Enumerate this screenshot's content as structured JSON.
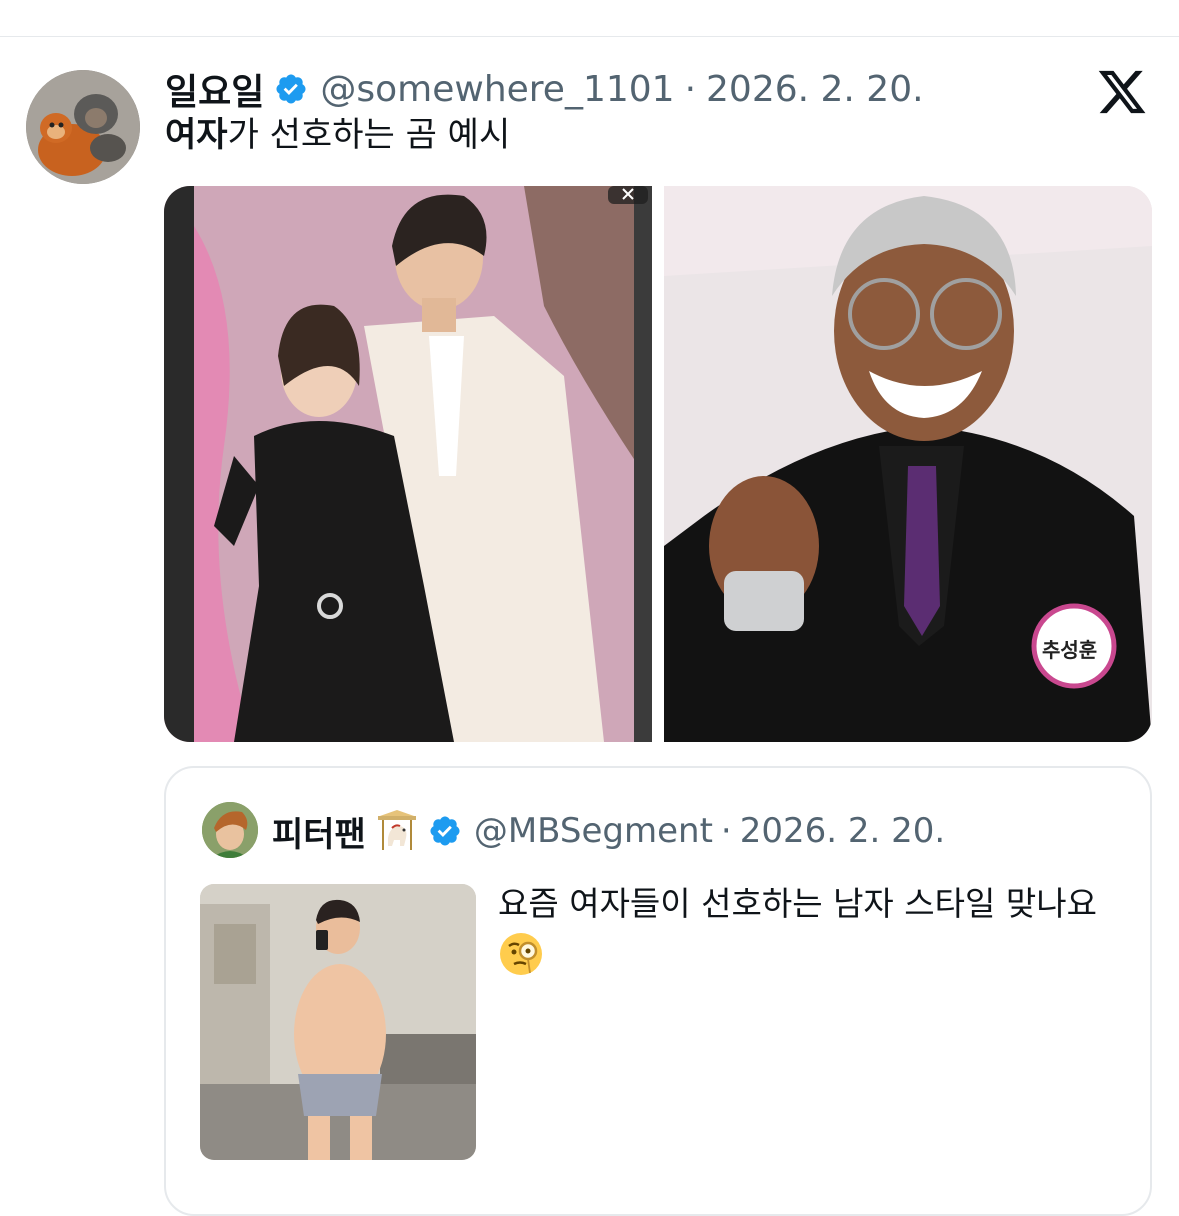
{
  "tweet": {
    "author": {
      "display_name": "일요일",
      "handle": "@somewhere_1101",
      "verified": true,
      "avatar_icon": "avatar-orangutan-plush"
    },
    "separator": "·",
    "date": "2026. 2. 20.",
    "text_bold": "여자",
    "text_rest": "가 선호하는 곰 예시",
    "brand_icon": "x-logo-icon",
    "media": [
      {
        "name": "photo-couple-red-carpet",
        "icon": "photo"
      },
      {
        "name": "photo-man-finger-heart",
        "icon": "photo",
        "badge_text": "추성훈"
      }
    ]
  },
  "quoted_tweet": {
    "author": {
      "display_name": "피터팬",
      "emoji_icon": "carousel-horse-emoji",
      "handle": "@MBSegment",
      "verified": true
    },
    "separator": "·",
    "date": "2026. 2. 20.",
    "text": "요즘 여자들이 선호하는 남자 스타일 맞나요",
    "text_emoji_icon": "face-with-monocle-emoji"
  },
  "colors": {
    "text_primary": "#0f1419",
    "text_secondary": "#536471",
    "verified_blue": "#1d9bf0",
    "border": "#e6e9ec"
  }
}
